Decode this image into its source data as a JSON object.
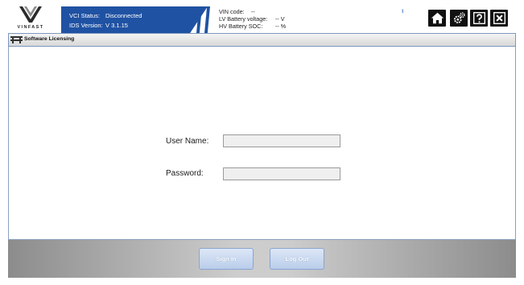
{
  "brand": {
    "logo_text": "VINFAST"
  },
  "status": {
    "vci_label": "VCI Status:",
    "vci_value": "Disconnected",
    "ids_label": "IDS Version:",
    "ids_value": "V  3.1.15"
  },
  "vehicle": {
    "vin_label": "VIN code:",
    "vin_value": "--",
    "lv_label": "LV Battery voltage:",
    "lv_value": "-- V",
    "hv_label": "HV Battery SOC:",
    "hv_value": "-- %"
  },
  "signal": {
    "icon": "signal-bars-icon",
    "text": "'ıll"
  },
  "toolbar": {
    "home_icon": "home-icon",
    "settings_icon": "gear-icon",
    "help_icon": "help-icon",
    "close_icon": "close-icon"
  },
  "page": {
    "title": "Software Licensing"
  },
  "form": {
    "username_label": "User Name:",
    "username_value": "",
    "password_label": "Password:",
    "password_value": ""
  },
  "footer": {
    "signin_label": "Sign In",
    "logout_label": "Log Out"
  },
  "colors": {
    "accent": "#1f52a3",
    "button": "#c8d8f0",
    "footer": "#b4b4b4"
  }
}
